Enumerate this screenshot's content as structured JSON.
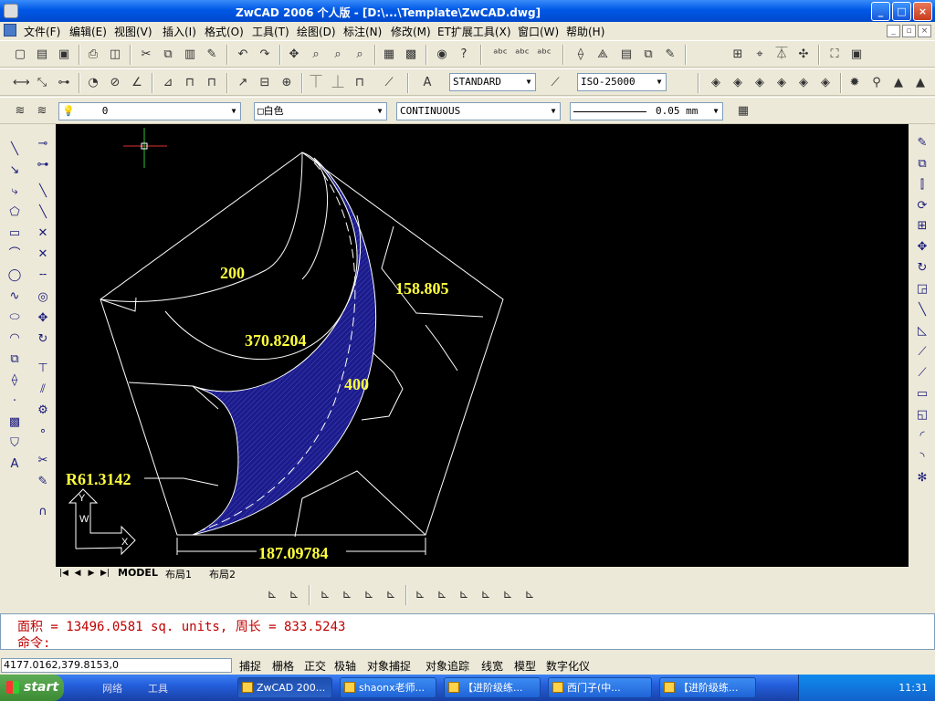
{
  "window": {
    "title": "ZwCAD 2006 个人版 - [D:\\...\\Template\\ZwCAD.dwg]",
    "minimize": "_",
    "maximize": "□",
    "close": "×"
  },
  "menu": [
    "文件(F)",
    "编辑(E)",
    "视图(V)",
    "插入(I)",
    "格式(O)",
    "工具(T)",
    "绘图(D)",
    "标注(N)",
    "修改(M)",
    "ET扩展工具(X)",
    "窗口(W)",
    "帮助(H)"
  ],
  "toolbar": {
    "text_style": "STANDARD",
    "dim_style": "ISO-25000",
    "layer": "0",
    "color": "□白色",
    "linetype": "CONTINUOUS",
    "lineweight": "0.05 mm"
  },
  "drawing": {
    "dim_200": "200",
    "dim_158": "158.805",
    "dim_370": "370.8204",
    "dim_400": "400",
    "dim_r61": "R61.3142",
    "dim_187": "187.09784",
    "ucs_x": "X",
    "ucs_y": "Y",
    "ucs_w": "W"
  },
  "tabs": {
    "model": "MODEL",
    "layout1": "布局1",
    "layout2": "布局2"
  },
  "command": {
    "line1": "面积 = 13496.0581 sq. units, 周长 = 833.5243",
    "prompt": "命令:"
  },
  "status": {
    "coords": "4177.0162,379.8153,0",
    "buttons": [
      "捕捉",
      "栅格",
      "正交",
      "极轴",
      "对象捕捉",
      "对象追踪",
      "线宽",
      "模型",
      "数字化仪"
    ]
  },
  "taskbar": {
    "start": "start",
    "quick": [
      "网络",
      "工具"
    ],
    "tasks": [
      "ZwCAD 200...",
      "shaonx老师...",
      "【进阶级练...",
      "西门子(中...",
      "【进阶级练..."
    ],
    "clock": "11:31"
  },
  "colors": {
    "accent": "#0058E6",
    "dim_text": "#FFFF3C",
    "hatch": "#1B1B8C",
    "command_text": "#C00000"
  }
}
